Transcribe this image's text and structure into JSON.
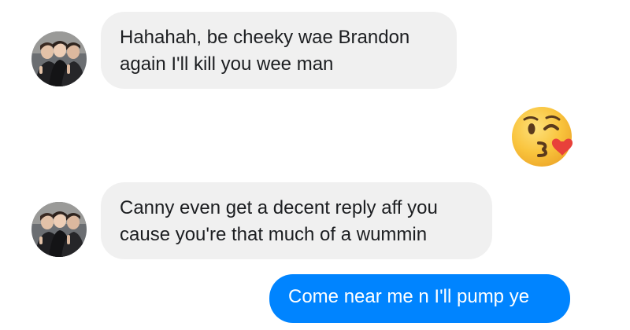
{
  "conversation": {
    "messages": [
      {
        "sender": "contact",
        "lines": [
          "Hahahah, be cheeky wae Brandon",
          "again I'll kill you wee man"
        ]
      },
      {
        "sender": "me",
        "emoji": "kissing-face-with-heart-icon"
      },
      {
        "sender": "contact",
        "lines": [
          "Canny even get a decent reply aff you",
          "cause you're that much of a wummin"
        ]
      },
      {
        "sender": "me",
        "text": "Come near me n I'll pump ye"
      }
    ]
  },
  "colors": {
    "received_bubble": "#f0f0f0",
    "sent_bubble": "#0084ff",
    "received_text": "#1c1e21",
    "sent_text": "#ffffff",
    "emoji_face": "#f8b83a",
    "emoji_heart": "#e8413a"
  }
}
